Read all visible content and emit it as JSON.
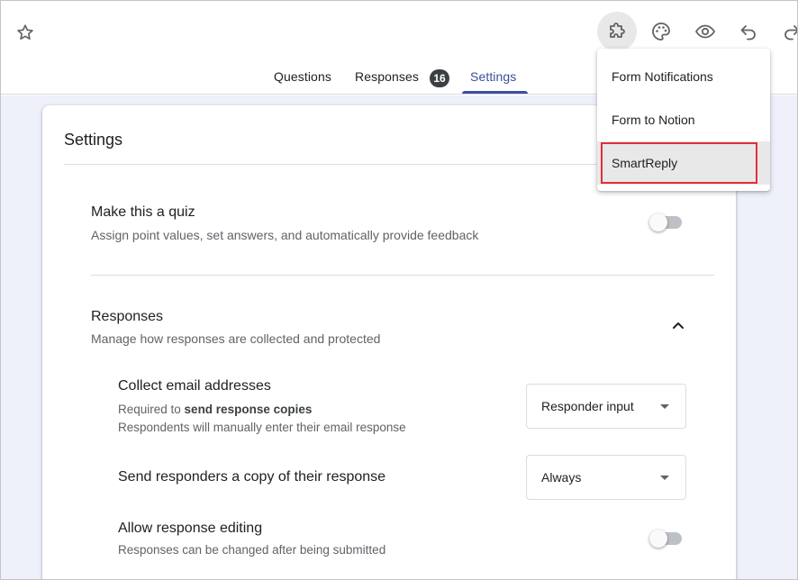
{
  "header": {
    "tabs": [
      {
        "label": "Questions"
      },
      {
        "label": "Responses",
        "badge": "16"
      },
      {
        "label": "Settings",
        "selected": true
      }
    ],
    "toolbar_icons": [
      "add-ons-puzzle-icon",
      "palette-icon",
      "preview-eye-icon",
      "undo-icon",
      "redo-icon"
    ],
    "favorite_icon": "star-icon"
  },
  "addons_menu": {
    "items": [
      "Form Notifications",
      "Form to Notion",
      "SmartReply"
    ],
    "highlighted_item": "SmartReply",
    "highlight_color": "#e0303a"
  },
  "settings": {
    "title": "Settings",
    "quiz": {
      "title": "Make this a quiz",
      "description": "Assign point values, set answers, and automatically provide feedback",
      "enabled": false
    },
    "responses": {
      "title": "Responses",
      "description": "Manage how responses are collected and protected",
      "expanded": true,
      "collect_email": {
        "title": "Collect email addresses",
        "desc_prefix": "Required to ",
        "desc_bold": "send response copies",
        "desc_line2": "Respondents will manually enter their email response",
        "value": "Responder input"
      },
      "send_copy": {
        "title": "Send responders a copy of their response",
        "value": "Always"
      },
      "allow_editing": {
        "title": "Allow response editing",
        "description": "Responses can be changed after being submitted",
        "enabled": false
      }
    }
  },
  "colors": {
    "accent": "#3c4e9e",
    "background": "#eef0fa"
  }
}
